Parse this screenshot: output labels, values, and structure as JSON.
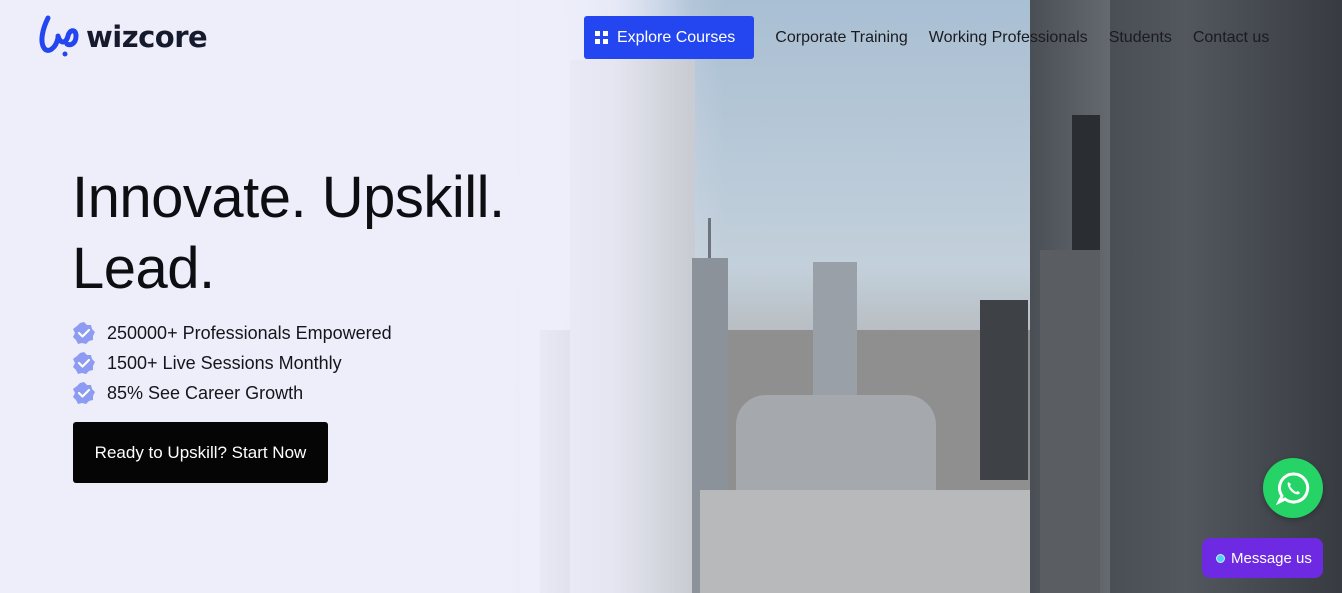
{
  "brand": {
    "name": "wizcore"
  },
  "nav": {
    "cta_label": "Explore Courses",
    "links": [
      "Corporate Training",
      "Working Professionals",
      "Students",
      "Contact us"
    ]
  },
  "hero": {
    "title_line1": "Innovate. Upskill.",
    "title_line2": "Lead.",
    "bullets": [
      "250000+ Professionals Empowered",
      "1500+ Live Sessions Monthly",
      "85% See Career Growth"
    ],
    "cta_label": "Ready to Upskill? Start Now"
  },
  "chat": {
    "message_label": "Message us"
  },
  "colors": {
    "accent": "#2446f0",
    "badge": "#8d9cf2",
    "whatsapp": "#25d366",
    "message": "#6d2ae2"
  },
  "icons": [
    "grid-icon",
    "verified-badge-icon",
    "whatsapp-icon",
    "online-dot-icon"
  ]
}
